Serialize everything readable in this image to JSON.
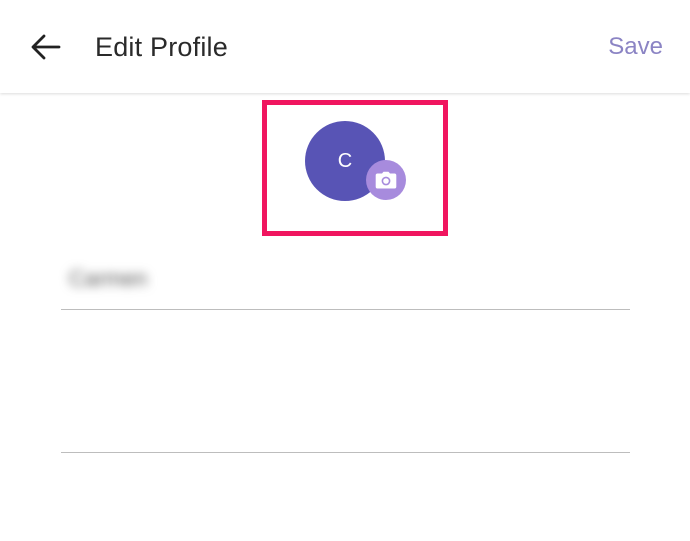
{
  "header": {
    "title": "Edit Profile",
    "save_label": "Save",
    "back_icon": "arrow-left-icon"
  },
  "profile": {
    "avatar_initial": "C",
    "camera_icon": "camera-icon"
  },
  "form": {
    "name_value": "Carmen",
    "bio_value": ""
  },
  "colors": {
    "avatar": "#5854b5",
    "camera_badge": "#a78bdd",
    "save_text": "#8b84c4",
    "highlight": "#f0155f"
  }
}
